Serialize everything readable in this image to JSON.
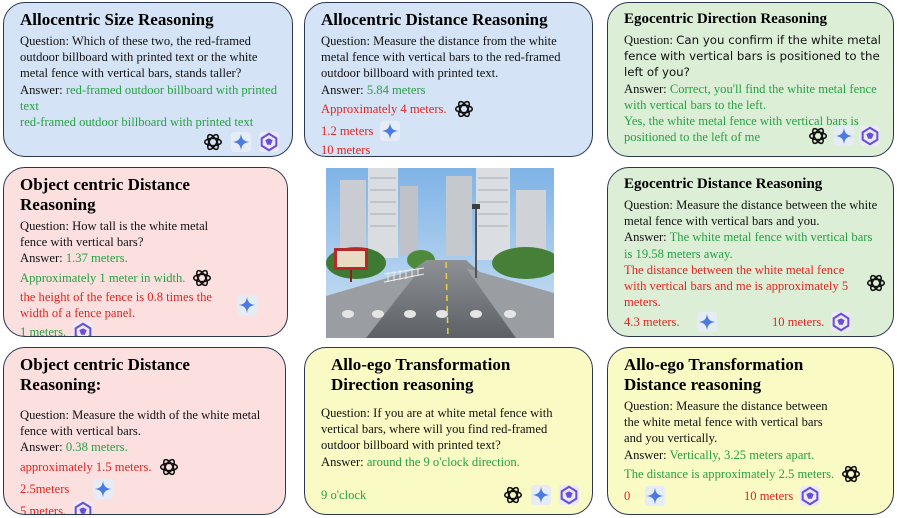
{
  "colors": {
    "ground_truth": "#26a043",
    "wrong": "#e32420",
    "model_icons": [
      "chatgpt-icon",
      "gemini-icon",
      "qwen-icon"
    ]
  },
  "cards": {
    "c1": {
      "title": "Allocentric Size Reasoning",
      "question": "Question: Which of these two, the red-framed outdoor billboard with printed text or the white metal fence with vertical bars, stands taller?",
      "answer_label": "Answer:",
      "answer": "red-framed outdoor billboard with printed text",
      "resp": "red-framed outdoor billboard with printed text"
    },
    "c2": {
      "title": "Allocentric Distance Reasoning",
      "question": "Question: Measure the distance from the white metal fence with vertical bars to the red-framed outdoor billboard with printed text.",
      "answer_label": "Answer:",
      "answer": "5.84 meters",
      "resp1": "Approximately 4 meters.",
      "resp2": "1.2 meters",
      "resp3": "10 meters"
    },
    "c3": {
      "title": "Egocentric Direction Reasoning",
      "question_prefix": "Question: ",
      "question": "Can you confirm if the white metal fence with vertical bars is positioned to the left of you?",
      "answer_label": "Answer:",
      "answer": "Correct, you'll find the white metal fence with vertical bars to the left.",
      "resp": "Yes, the white metal fence with vertical bars is positioned to the left of me"
    },
    "c4": {
      "title": "Object centric Distance Reasoning",
      "question": "Question: How tall is the white metal fence with vertical bars?",
      "answer_label": "Answer:",
      "answer": "1.37 meters.",
      "resp1": "Approximately 1 meter in width.",
      "resp2": "the height of the fence is 0.8 times the width of a fence panel.",
      "resp3": "1 meters."
    },
    "c5": {
      "title": "Egocentric Distance Reasoning",
      "question": "Question: Measure the distance between the white metal fence with vertical bars and you.",
      "answer_label": "Answer:",
      "answer": "The white metal fence with vertical bars is 19.58 meters away.",
      "resp1": "The distance between the white metal fence with vertical bars and me is approximately 5 meters.",
      "resp2": "4.3 meters.",
      "resp3": "10 meters."
    },
    "c6": {
      "title": "Object centric Distance Reasoning:",
      "question": "Question: Measure the width of the white metal fence with vertical bars.",
      "answer_label": "Answer:",
      "answer": "0.38 meters.",
      "resp1": "approximately 1.5 meters.",
      "resp2": "2.5meters",
      "resp3": "5 meters."
    },
    "c7": {
      "title": "Allo-ego Transformation Direction reasoning",
      "question": "Question: If you are at white metal fence with vertical bars, where will you find red-framed outdoor billboard with printed text?",
      "answer_label": "Answer:",
      "answer": "around the 9 o'clock direction.",
      "resp": "9 o'clock"
    },
    "c8": {
      "title": "Allo-ego Transformation Distance reasoning",
      "question": "Question: Measure the distance between the white metal fence with vertical bars and you vertically.",
      "answer_label": "Answer:",
      "answer": "Vertically, 3.25 meters apart.",
      "resp1": "The distance is approximately 2.5 meters.",
      "resp2": "0",
      "resp3": "10 meters"
    }
  }
}
